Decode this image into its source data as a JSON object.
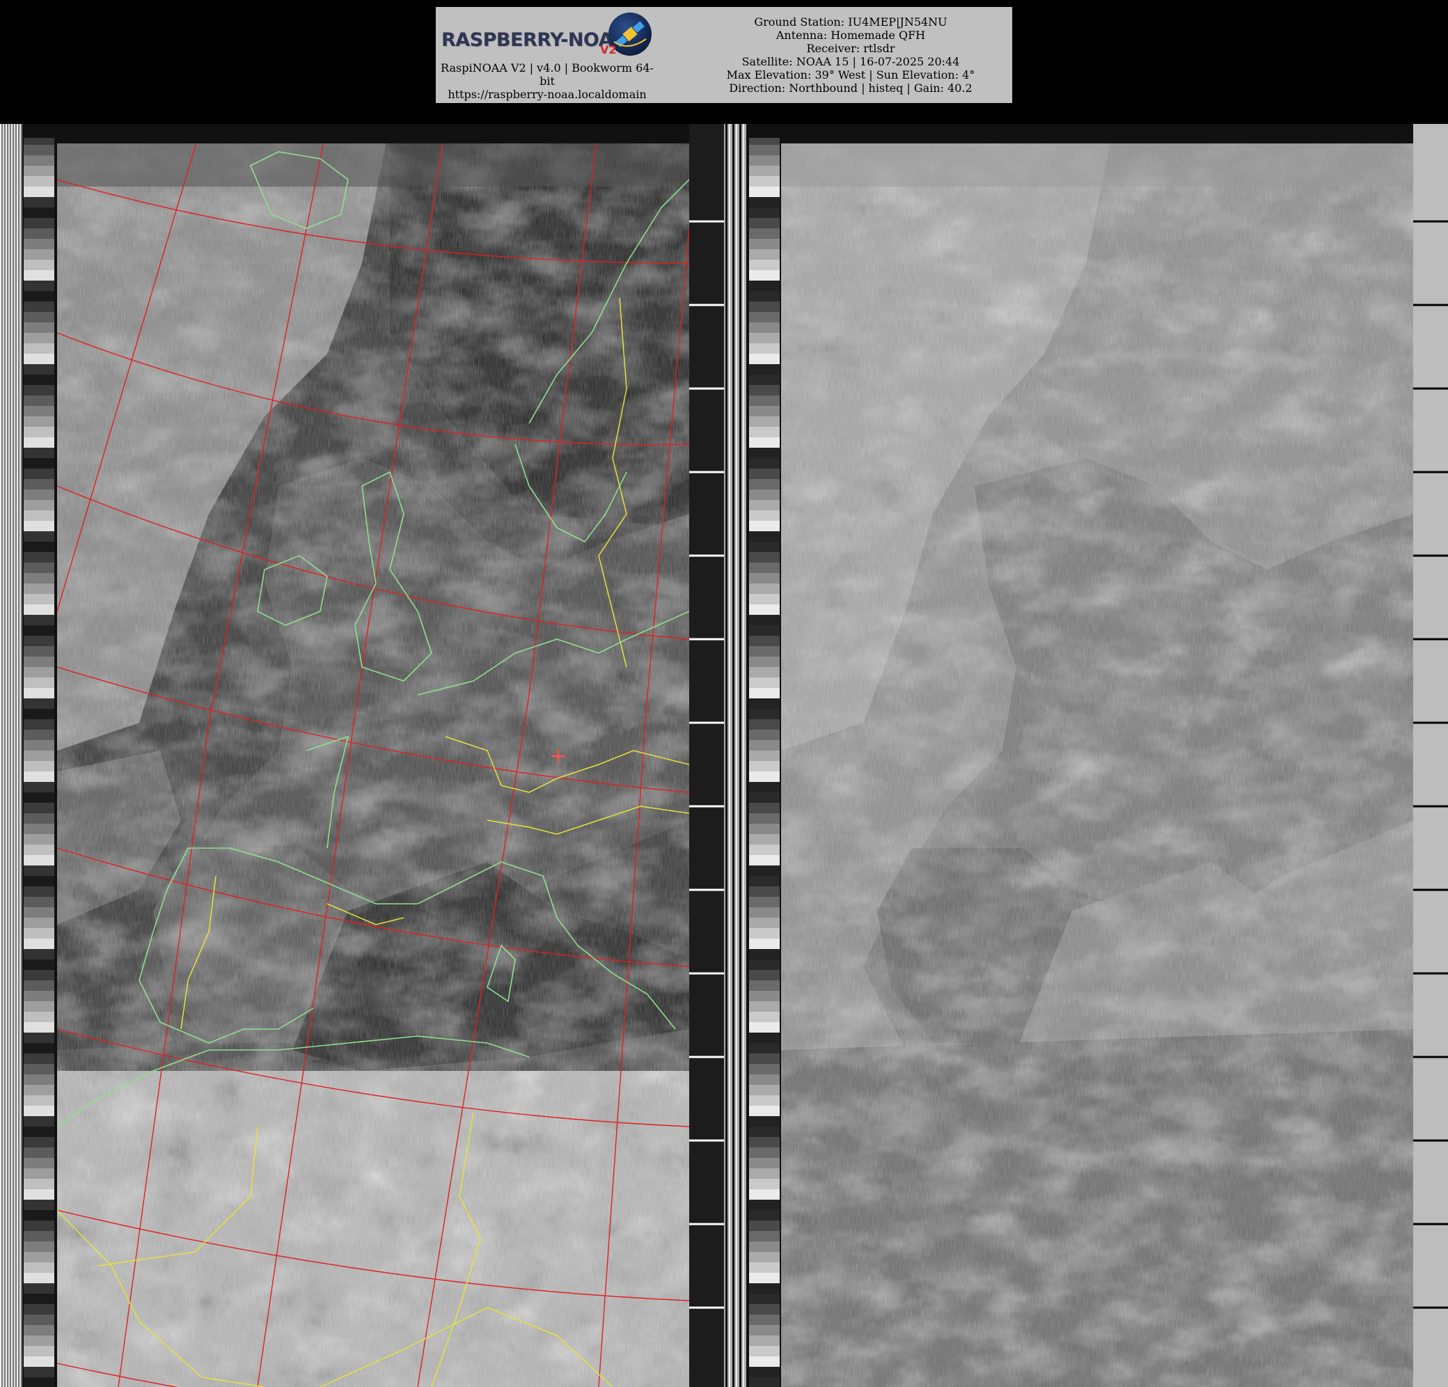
{
  "header": {
    "logo_text": "RASPBERRY-NOAA",
    "logo_badge": "V2",
    "version_lines": [
      "RaspiNOAA V2 | v4.0 | Bookworm 64-",
      "bit",
      "https://raspberry-noaa.localdomain"
    ],
    "station_lines": [
      "Ground Station: IU4MEP|JN54NU",
      "Antenna: Homemade QFH",
      "Receiver: rtlsdr",
      "Satellite: NOAA 15 | 16-07-2025 20:44",
      "Max Elevation: 39° West | Sun Elevation: 4°",
      "Direction: Northbound | histeq | Gain: 40.2"
    ]
  },
  "imagery": {
    "description_icons": [
      "satellite-icon",
      "crosshair-icon"
    ],
    "colors": {
      "graticule": "#e02020",
      "coastline": "#8fe08f",
      "border": "#e8e23a",
      "marker": "#ff5050"
    }
  }
}
